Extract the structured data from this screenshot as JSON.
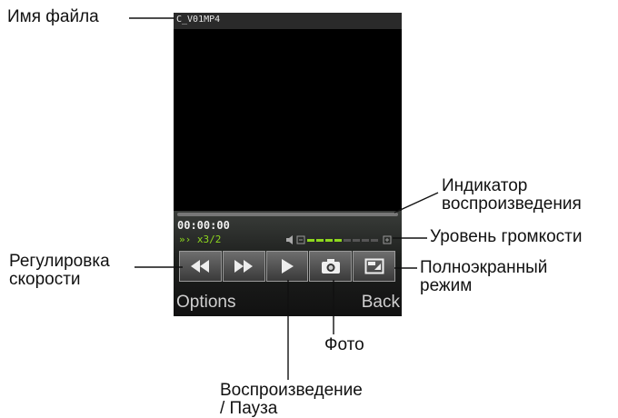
{
  "callouts": {
    "filename": "Имя файла",
    "progress": "Индикатор\nвоспроизведения",
    "volume": "Уровень громкости",
    "speed": "Регулировка\nскорости",
    "fullscreen": "Полноэкранный\nрежим",
    "photo": "Фото",
    "play_pause": "Воспроизведение\n/ Пауза"
  },
  "player": {
    "file_name": "C_V01MP4",
    "time": "00:00:00",
    "speed": "x3/2",
    "progress": 0.0,
    "volume_level": 4,
    "volume_max": 8,
    "buttons": [
      "rewind-icon",
      "fast-forward-icon",
      "play-icon",
      "camera-icon",
      "fullscreen-icon"
    ],
    "softkeys": {
      "left": "Options",
      "right": "Back"
    }
  },
  "colors": {
    "accent": "#8ed81e",
    "background": "#000000"
  }
}
